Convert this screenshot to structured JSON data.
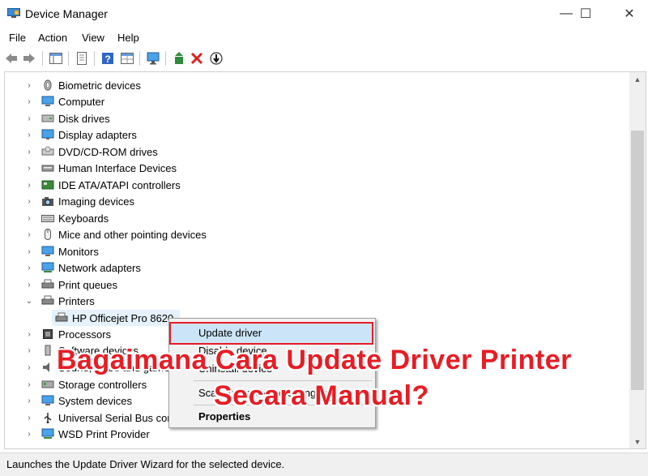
{
  "window": {
    "title": "Device Manager",
    "controls": {
      "minimize": "—",
      "maximize": "☐",
      "close": "✕"
    }
  },
  "menu": [
    "File",
    "Action",
    "View",
    "Help"
  ],
  "tree": {
    "items": [
      {
        "label": "Biometric devices",
        "expanded": false,
        "icon": "fingerprint-icon"
      },
      {
        "label": "Computer",
        "expanded": false,
        "icon": "computer-icon"
      },
      {
        "label": "Disk drives",
        "expanded": false,
        "icon": "disk-drive-icon"
      },
      {
        "label": "Display adapters",
        "expanded": false,
        "icon": "display-adapter-icon"
      },
      {
        "label": "DVD/CD-ROM drives",
        "expanded": false,
        "icon": "dvd-drive-icon"
      },
      {
        "label": "Human Interface Devices",
        "expanded": false,
        "icon": "hid-icon"
      },
      {
        "label": "IDE ATA/ATAPI controllers",
        "expanded": false,
        "icon": "ide-controller-icon"
      },
      {
        "label": "Imaging devices",
        "expanded": false,
        "icon": "camera-icon"
      },
      {
        "label": "Keyboards",
        "expanded": false,
        "icon": "keyboard-icon"
      },
      {
        "label": "Mice and other pointing devices",
        "expanded": false,
        "icon": "mouse-icon"
      },
      {
        "label": "Monitors",
        "expanded": false,
        "icon": "monitor-icon"
      },
      {
        "label": "Network adapters",
        "expanded": false,
        "icon": "network-adapter-icon"
      },
      {
        "label": "Print queues",
        "expanded": false,
        "icon": "print-queue-icon"
      },
      {
        "label": "Printers",
        "expanded": true,
        "icon": "printer-icon"
      },
      {
        "label": "Processors",
        "expanded": false,
        "icon": "processor-icon"
      },
      {
        "label": "Software devices",
        "expanded": false,
        "icon": "software-device-icon"
      },
      {
        "label": "Sound, video and game controllers",
        "expanded": false,
        "icon": "speaker-icon"
      },
      {
        "label": "Storage controllers",
        "expanded": false,
        "icon": "storage-controller-icon"
      },
      {
        "label": "System devices",
        "expanded": false,
        "icon": "system-device-icon"
      },
      {
        "label": "Universal Serial Bus controllers",
        "expanded": false,
        "icon": "usb-icon"
      },
      {
        "label": "WSD Print Provider",
        "expanded": false,
        "icon": "wsd-provider-icon"
      }
    ],
    "selected_child": "HP Officejet Pro 8620"
  },
  "context_menu": {
    "items": [
      "Update driver",
      "Disable device",
      "Uninstall device",
      "Scan for hardware changes",
      "Properties"
    ],
    "highlighted": "Update driver"
  },
  "overlay": {
    "line1": "Bagaimana Cara Update Driver Printer",
    "line2": "Secara Manual?"
  },
  "status": "Launches the Update Driver Wizard for the selected device.",
  "colors": {
    "accent_red": "#e81c24",
    "highlight": "#cce4f7",
    "selection": "#e5f1fb"
  }
}
